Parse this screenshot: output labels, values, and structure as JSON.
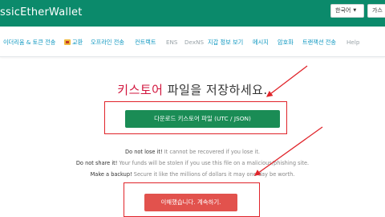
{
  "header": {
    "brand": "ssicEtherWallet",
    "language": "한국어",
    "gas_label": "가스"
  },
  "nav": {
    "items": [
      {
        "label": "이더리움 & 토큰 전송",
        "muted": false
      },
      {
        "label": "교환",
        "muted": false,
        "icon": "swap-icon"
      },
      {
        "label": "오프라인 전송",
        "muted": false
      },
      {
        "label": "컨트랙트",
        "muted": false
      },
      {
        "label": "ENS",
        "muted": true
      },
      {
        "label": "DexNS",
        "muted": true
      },
      {
        "label": "지갑 정보 보기",
        "muted": false
      },
      {
        "label": "메시지",
        "muted": false
      },
      {
        "label": "암호화",
        "muted": false
      },
      {
        "label": "트랜잭션 전송",
        "muted": false
      },
      {
        "label": "Help",
        "muted": true
      }
    ]
  },
  "main": {
    "title_accent": "키스토어",
    "title_rest": " 파일을 저장하세요.",
    "download_label": "다운로드 키스토어 파일 (UTC / JSON)",
    "warnings": [
      {
        "strong": "Do not lose it!",
        "rest": " It cannot be recovered if you lose it."
      },
      {
        "strong": "Do not share it!",
        "rest": " Your funds will be stolen if you use this file on a malicious/phishing site."
      },
      {
        "strong": "Make a backup!",
        "rest": " Secure it like the millions of dollars it may one day be worth."
      }
    ],
    "confirm_label": "이해했습니다. 계속하기."
  },
  "colors": {
    "header_bg": "#0b8a6b",
    "link": "#0e97c0",
    "accent": "#d2163e",
    "download_bg": "#1a8c55",
    "confirm_bg": "#e2524d",
    "annotation": "#e0242a"
  }
}
